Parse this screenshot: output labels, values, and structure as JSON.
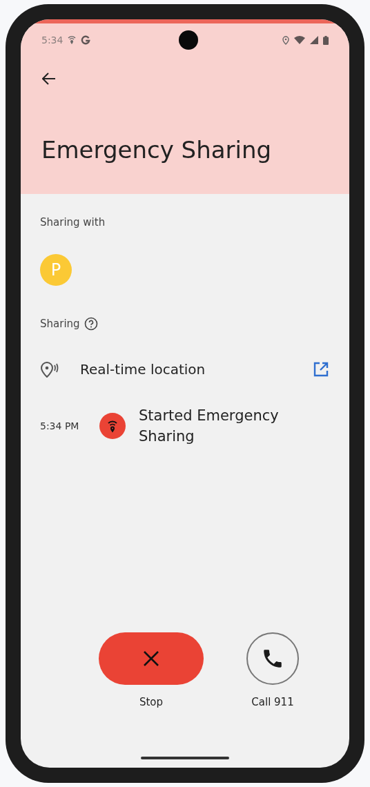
{
  "status_bar": {
    "time": "5:34"
  },
  "header": {
    "title": "Emergency Sharing"
  },
  "sharing_with": {
    "label": "Sharing with",
    "contacts": [
      {
        "initial": "P",
        "color": "#fbc935"
      }
    ]
  },
  "sharing": {
    "label": "Sharing",
    "items": [
      {
        "label": "Real-time location"
      }
    ]
  },
  "timeline": [
    {
      "time": "5:34 PM",
      "text": "Started Emergency Sharing"
    }
  ],
  "actions": [
    {
      "kind": "stop",
      "label": "Stop"
    },
    {
      "kind": "call",
      "label": "Call 911"
    }
  ]
}
